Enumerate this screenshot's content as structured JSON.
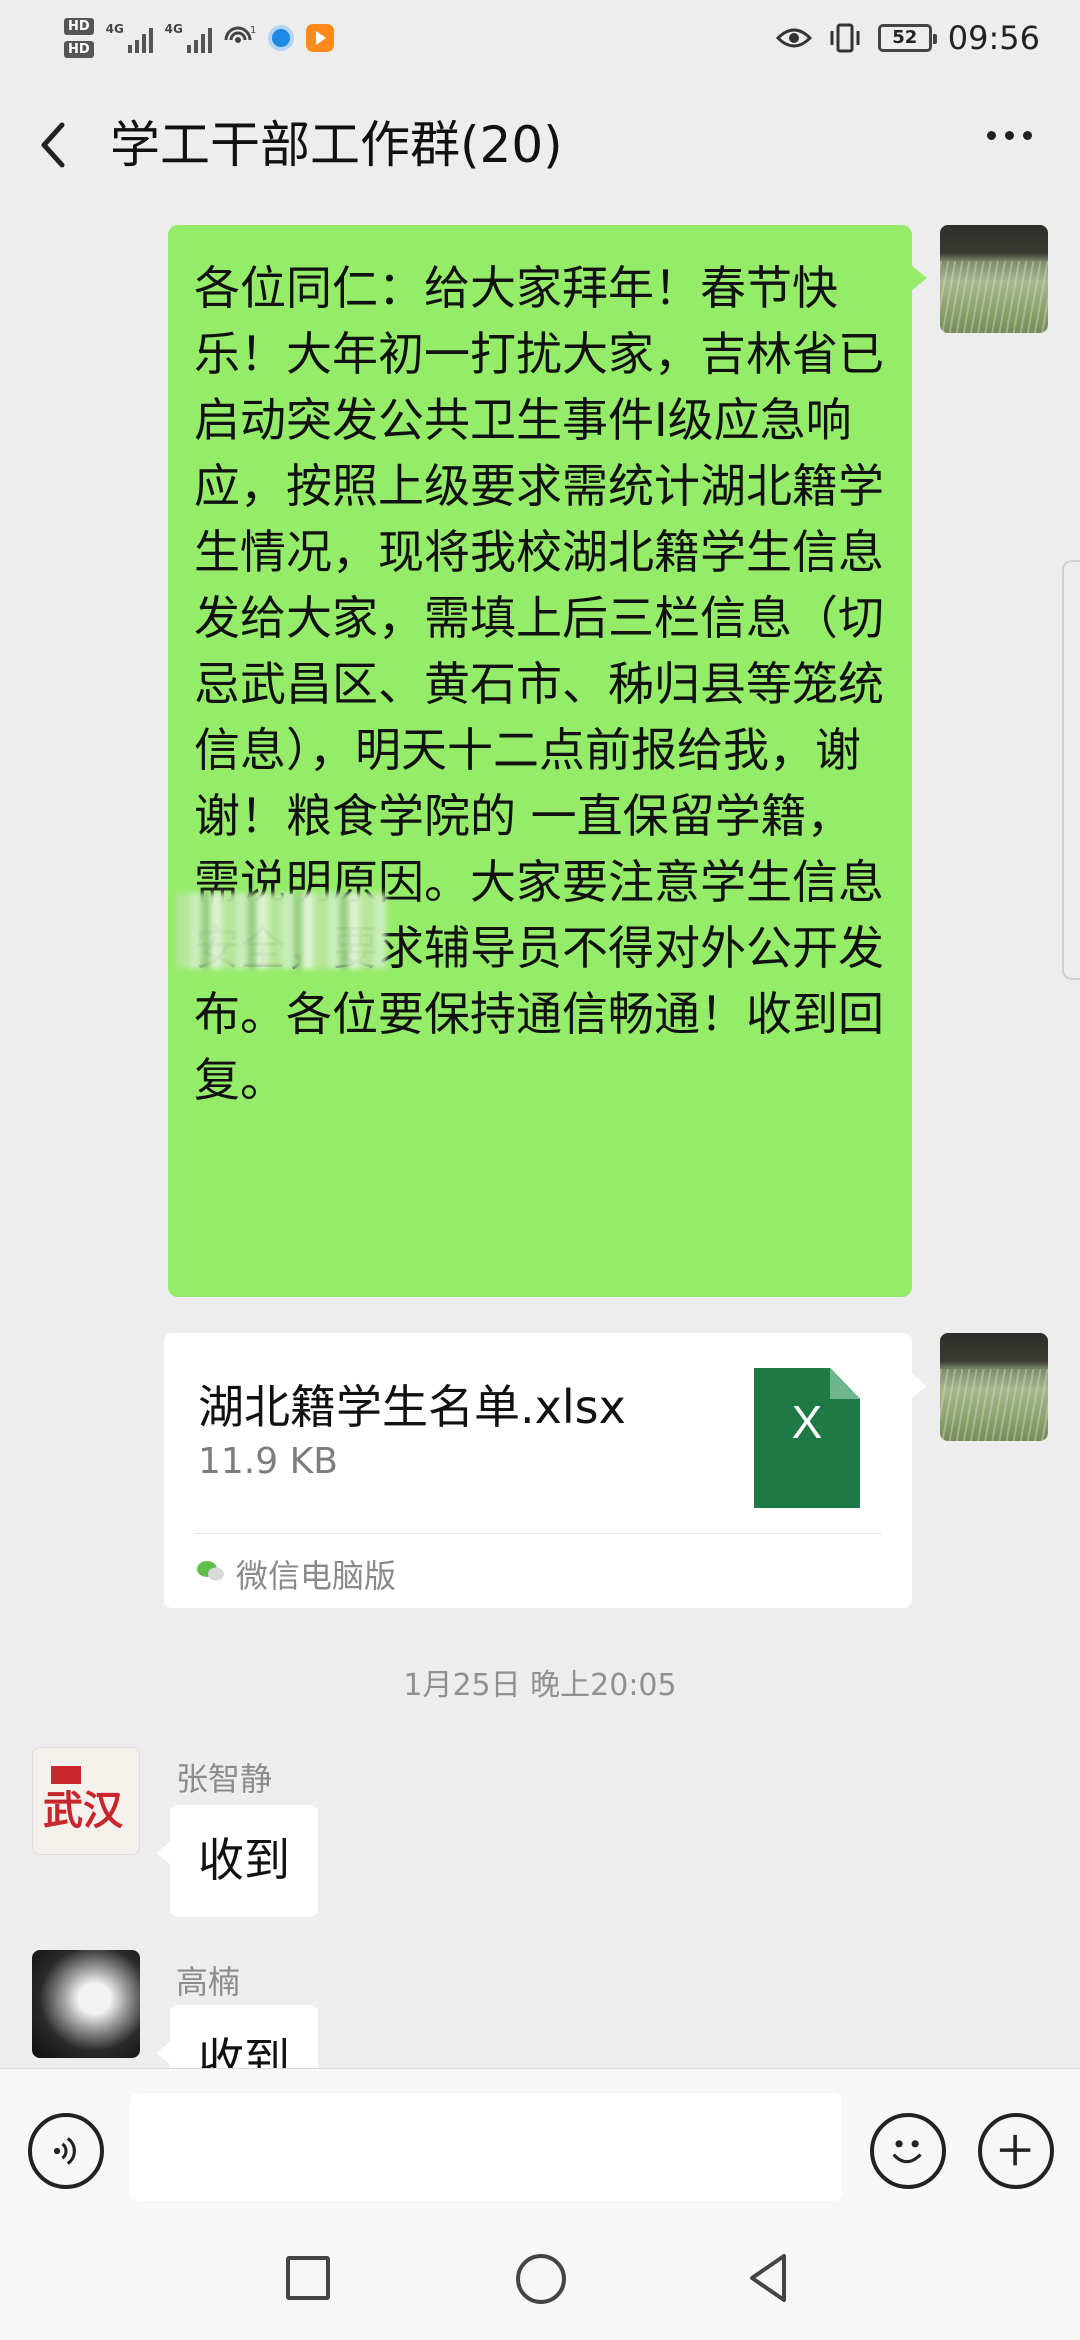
{
  "status_bar": {
    "hd1": "HD",
    "hd2": "HD",
    "net1": "4G",
    "net2": "4G",
    "wifi_badge": "1",
    "battery": "52",
    "time": "09:56"
  },
  "header": {
    "title": "学工干部工作群(20)"
  },
  "messages": {
    "announcement": "各位同仁：给大家拜年！春节快乐！大年初一打扰大家，吉林省已启动突发公共卫生事件Ⅰ级应急响应，按照上级要求需统计湖北籍学生情况，现将我校湖北籍学生信息发给大家，需填上后三栏信息（切忌武昌区、黄石市、秭归县等笼统信息），明天十二点前报给我，谢谢！粮食学院的         一直保留学籍，需说明原因。大家要注意学生信息安全，要求辅导员不得对外公开发布。各位要保持通信畅通！收到回复。",
    "file": {
      "name": "湖北籍学生名单.xlsx",
      "size": "11.9 KB",
      "icon_letter": "X",
      "source": "微信电脑版"
    },
    "timestamp": "1月25日 晚上20:05",
    "replies": [
      {
        "sender": "张智静",
        "text": "收到",
        "avatar_text": "武汉"
      },
      {
        "sender": "高楠",
        "text": "收到"
      }
    ]
  },
  "input_bar": {
    "placeholder": ""
  },
  "colors": {
    "sent_bubble": "#95ec69",
    "background": "#ededed",
    "excel_green": "#1d7a44"
  }
}
